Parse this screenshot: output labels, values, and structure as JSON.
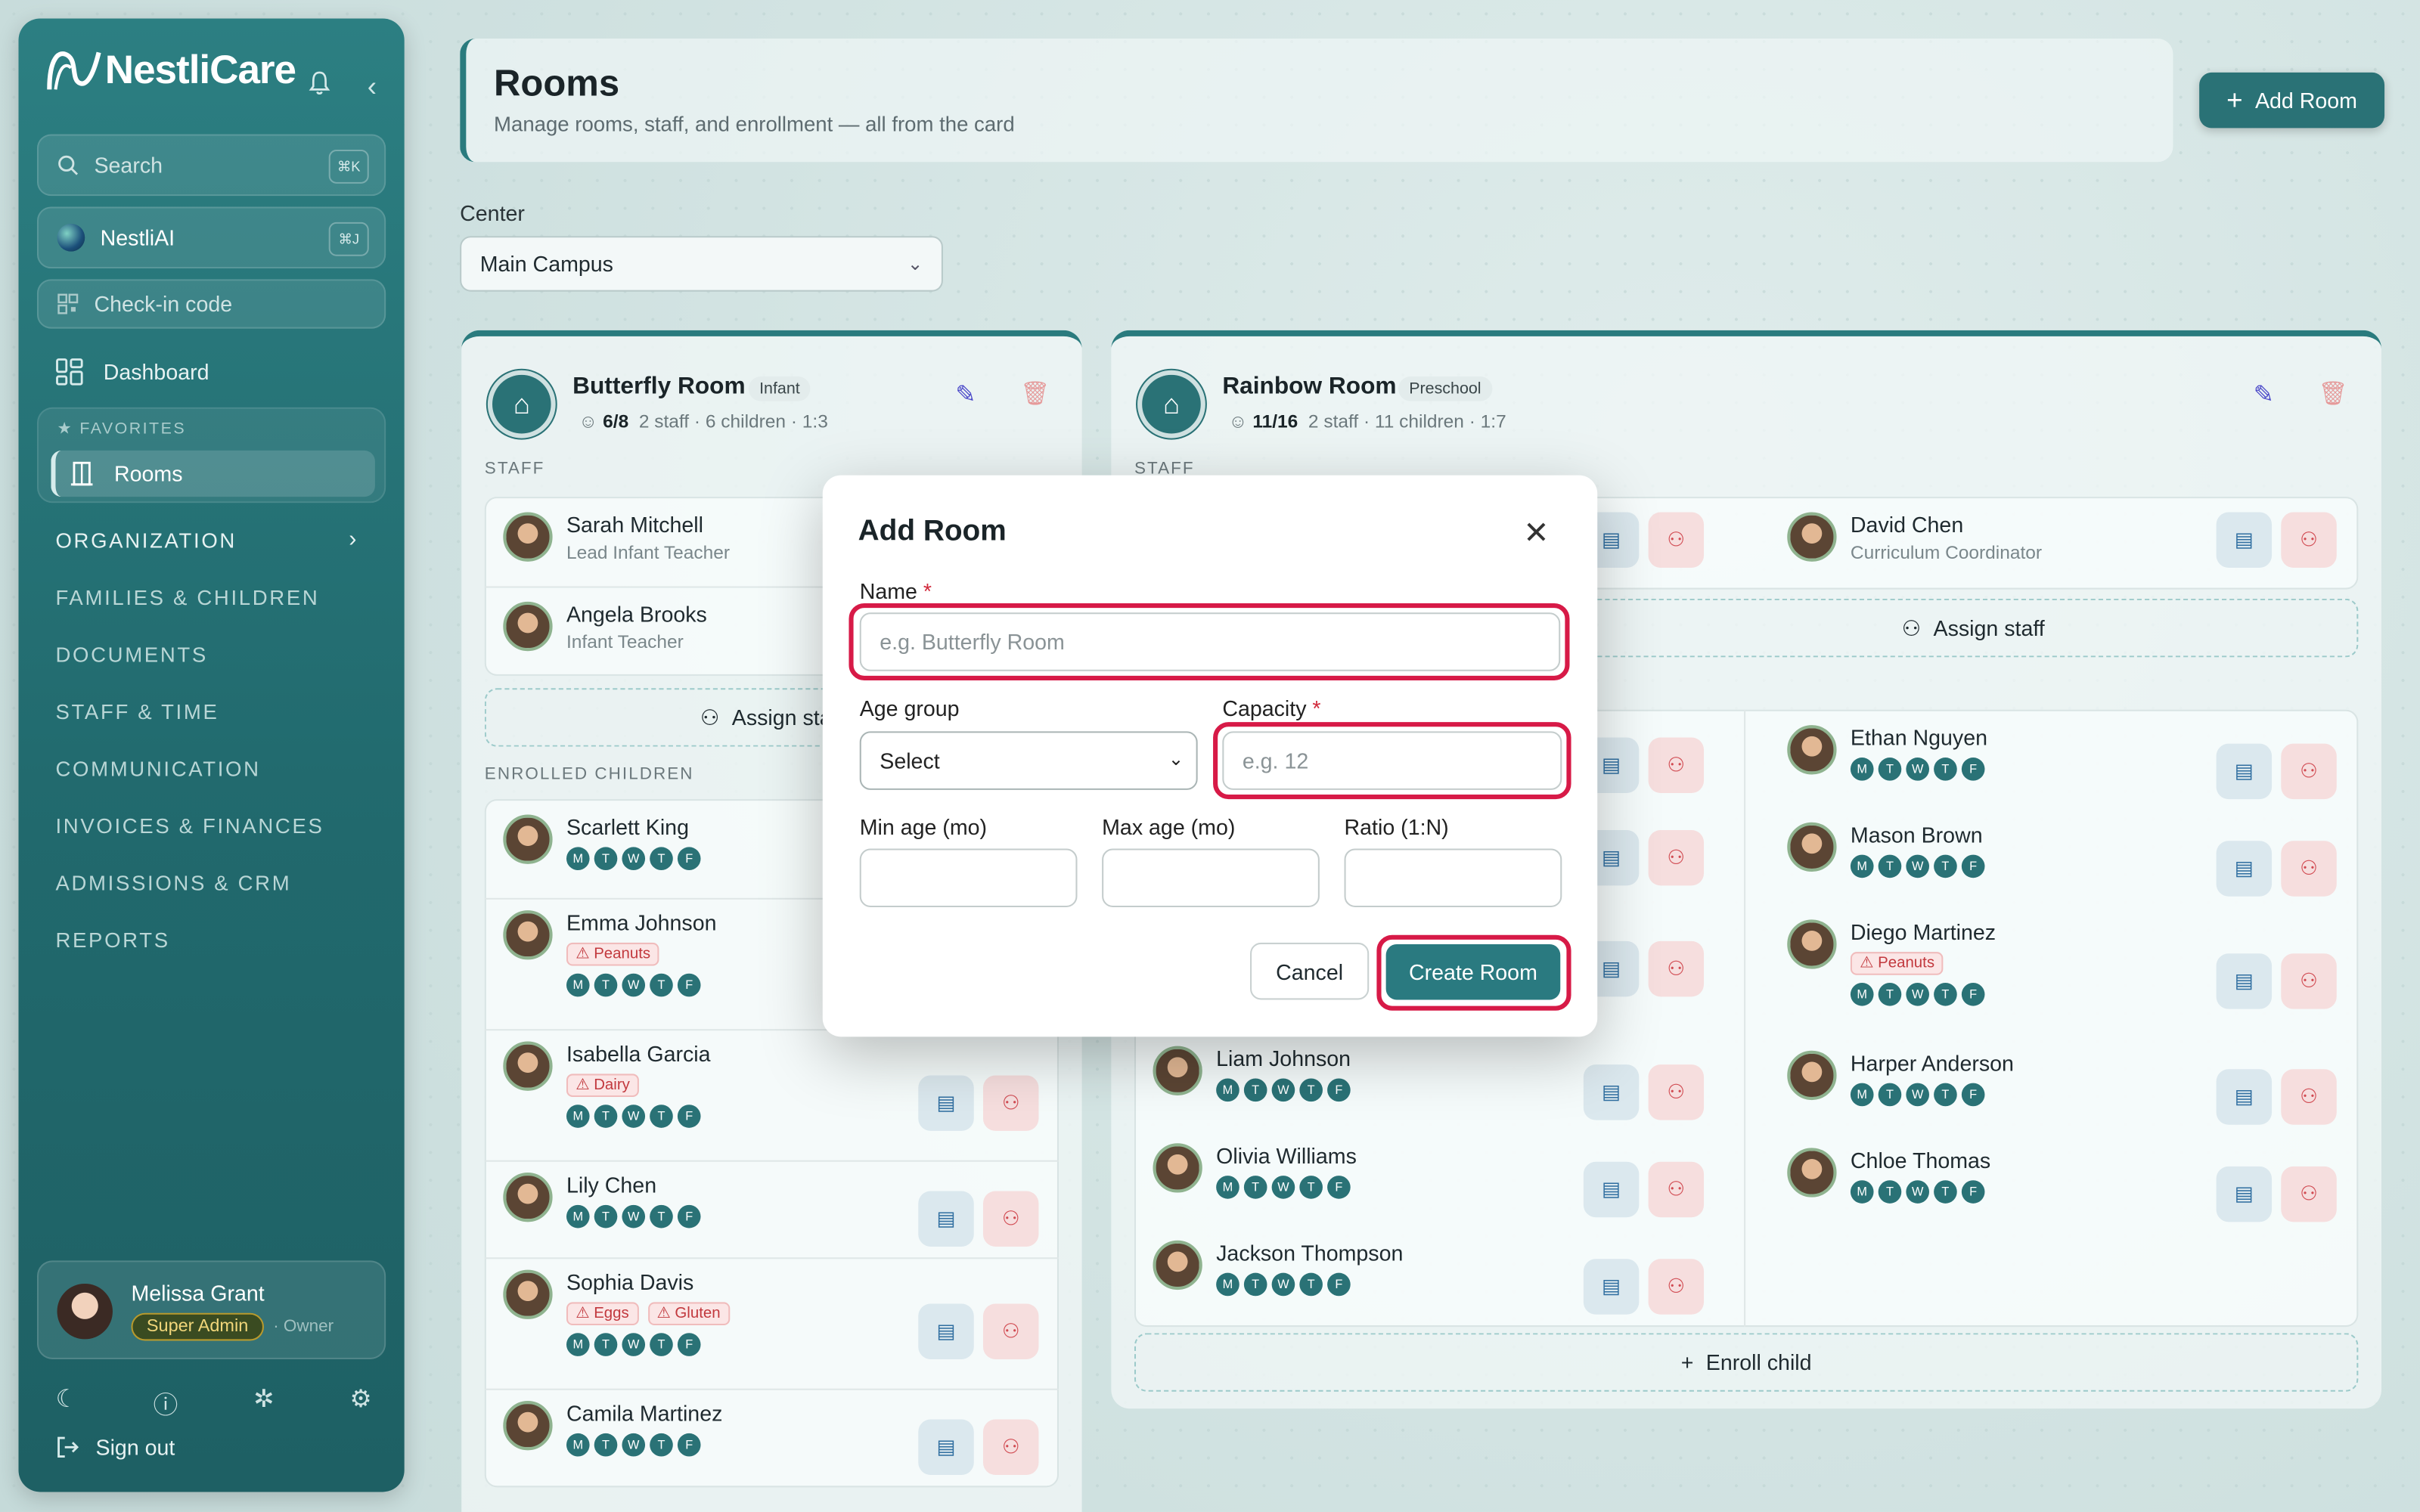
{
  "app": {
    "name": "NestliCare"
  },
  "sidebar": {
    "search_placeholder": "Search",
    "search_kbd": "⌘K",
    "ai_label": "NestliAI",
    "ai_kbd": "⌘J",
    "checkin_label": "Check-in code",
    "dashboard_label": "Dashboard",
    "favorites_label": "FAVORITES",
    "favorite_item": "Rooms",
    "sections": [
      "ORGANIZATION",
      "FAMILIES & CHILDREN",
      "DOCUMENTS",
      "STAFF & TIME",
      "COMMUNICATION",
      "INVOICES & FINANCES",
      "ADMISSIONS & CRM",
      "REPORTS"
    ],
    "user": {
      "name": "Melissa Grant",
      "role_badge": "Super Admin",
      "role_suffix": "· Owner"
    },
    "signout_label": "Sign out"
  },
  "header": {
    "title": "Rooms",
    "subtitle": "Manage rooms, staff, and enrollment — all from the card",
    "add_button": "Add Room"
  },
  "center": {
    "label": "Center",
    "value": "Main Campus"
  },
  "butterfly": {
    "name": "Butterfly Room",
    "tag": "Infant",
    "occupancy": "6/8",
    "meta": "2 staff · 6 children · 1:3",
    "staff_label": "STAFF",
    "staff": [
      {
        "name": "Sarah Mitchell",
        "role": "Lead Infant Teacher"
      },
      {
        "name": "Angela Brooks",
        "role": "Infant Teacher"
      }
    ],
    "assign_label": "Assign staff",
    "enrolled_label": "ENROLLED CHILDREN",
    "children": [
      {
        "name": "Scarlett King",
        "allergies": []
      },
      {
        "name": "Emma Johnson",
        "allergies": [
          "Peanuts"
        ]
      },
      {
        "name": "Isabella Garcia",
        "allergies": [
          "Dairy"
        ]
      },
      {
        "name": "Lily Chen",
        "allergies": []
      },
      {
        "name": "Sophia Davis",
        "allergies": [
          "Eggs",
          "Gluten"
        ]
      },
      {
        "name": "Camila Martinez",
        "allergies": []
      }
    ]
  },
  "rainbow": {
    "name": "Rainbow Room",
    "tag": "Preschool",
    "occupancy": "11/16",
    "meta": "2 staff · 11 children · 1:7",
    "staff_label": "STAFF",
    "staff": [
      {
        "name": "David Chen",
        "role": "Curriculum Coordinator"
      }
    ],
    "assign_label": "Assign staff",
    "children_left": [
      {
        "name": "Liam Johnson",
        "allergies": []
      },
      {
        "name": "Olivia Williams",
        "allergies": []
      },
      {
        "name": "Jackson Thompson",
        "allergies": []
      }
    ],
    "children_right": [
      {
        "name": "Ethan Nguyen",
        "allergies": []
      },
      {
        "name": "Mason Brown",
        "allergies": []
      },
      {
        "name": "Diego Martinez",
        "allergies": [
          "Peanuts"
        ]
      },
      {
        "name": "Harper Anderson",
        "allergies": []
      },
      {
        "name": "Chloe Thomas",
        "allergies": []
      }
    ],
    "enroll_label": "Enroll child"
  },
  "days": [
    "M",
    "T",
    "W",
    "T",
    "F"
  ],
  "modal": {
    "title": "Add Room",
    "name_label": "Name",
    "name_placeholder": "e.g. Butterfly Room",
    "age_group_label": "Age group",
    "age_group_value": "Select",
    "capacity_label": "Capacity",
    "capacity_placeholder": "e.g. 12",
    "min_age_label": "Min age (mo)",
    "max_age_label": "Max age (mo)",
    "ratio_label": "Ratio (1:N)",
    "required_mark": "*",
    "cancel_label": "Cancel",
    "create_label": "Create Room"
  }
}
